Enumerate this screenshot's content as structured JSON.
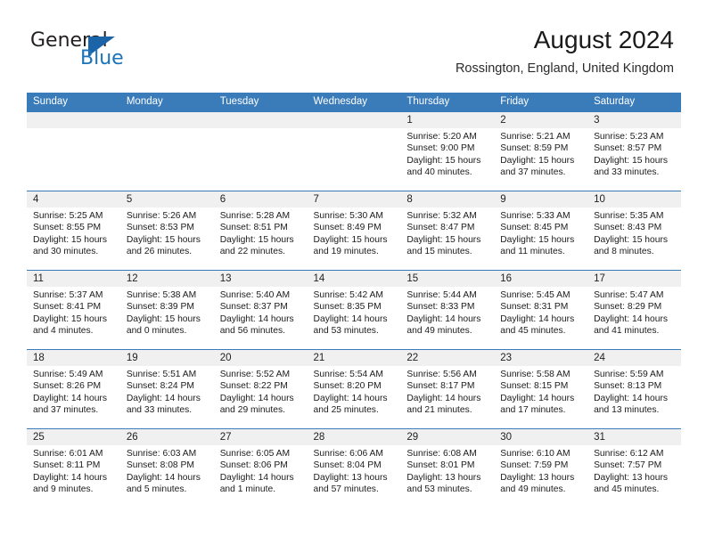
{
  "brand": {
    "name_part1": "General",
    "name_part2": "Blue",
    "triangle_icon": "triangle-logo-icon",
    "accent_color": "#1b74bb"
  },
  "header": {
    "title": "August 2024",
    "subtitle": "Rossington, England, United Kingdom"
  },
  "theme": {
    "header_row_bg": "#3a7cba",
    "daynum_band_bg": "#f0f0f0",
    "row_separator": "#3a7cba",
    "text_color": "#1b1b1b"
  },
  "weekdays": [
    "Sunday",
    "Monday",
    "Tuesday",
    "Wednesday",
    "Thursday",
    "Friday",
    "Saturday"
  ],
  "labels": {
    "sunrise_prefix": "Sunrise:",
    "sunset_prefix": "Sunset:",
    "daylight_prefix": "Daylight:"
  },
  "weeks": [
    [
      {
        "day": "",
        "sunrise": "",
        "sunset": "",
        "daylight_line1": "",
        "daylight_line2": ""
      },
      {
        "day": "",
        "sunrise": "",
        "sunset": "",
        "daylight_line1": "",
        "daylight_line2": ""
      },
      {
        "day": "",
        "sunrise": "",
        "sunset": "",
        "daylight_line1": "",
        "daylight_line2": ""
      },
      {
        "day": "",
        "sunrise": "",
        "sunset": "",
        "daylight_line1": "",
        "daylight_line2": ""
      },
      {
        "day": "1",
        "sunrise": "Sunrise: 5:20 AM",
        "sunset": "Sunset: 9:00 PM",
        "daylight_line1": "Daylight: 15 hours",
        "daylight_line2": "and 40 minutes."
      },
      {
        "day": "2",
        "sunrise": "Sunrise: 5:21 AM",
        "sunset": "Sunset: 8:59 PM",
        "daylight_line1": "Daylight: 15 hours",
        "daylight_line2": "and 37 minutes."
      },
      {
        "day": "3",
        "sunrise": "Sunrise: 5:23 AM",
        "sunset": "Sunset: 8:57 PM",
        "daylight_line1": "Daylight: 15 hours",
        "daylight_line2": "and 33 minutes."
      }
    ],
    [
      {
        "day": "4",
        "sunrise": "Sunrise: 5:25 AM",
        "sunset": "Sunset: 8:55 PM",
        "daylight_line1": "Daylight: 15 hours",
        "daylight_line2": "and 30 minutes."
      },
      {
        "day": "5",
        "sunrise": "Sunrise: 5:26 AM",
        "sunset": "Sunset: 8:53 PM",
        "daylight_line1": "Daylight: 15 hours",
        "daylight_line2": "and 26 minutes."
      },
      {
        "day": "6",
        "sunrise": "Sunrise: 5:28 AM",
        "sunset": "Sunset: 8:51 PM",
        "daylight_line1": "Daylight: 15 hours",
        "daylight_line2": "and 22 minutes."
      },
      {
        "day": "7",
        "sunrise": "Sunrise: 5:30 AM",
        "sunset": "Sunset: 8:49 PM",
        "daylight_line1": "Daylight: 15 hours",
        "daylight_line2": "and 19 minutes."
      },
      {
        "day": "8",
        "sunrise": "Sunrise: 5:32 AM",
        "sunset": "Sunset: 8:47 PM",
        "daylight_line1": "Daylight: 15 hours",
        "daylight_line2": "and 15 minutes."
      },
      {
        "day": "9",
        "sunrise": "Sunrise: 5:33 AM",
        "sunset": "Sunset: 8:45 PM",
        "daylight_line1": "Daylight: 15 hours",
        "daylight_line2": "and 11 minutes."
      },
      {
        "day": "10",
        "sunrise": "Sunrise: 5:35 AM",
        "sunset": "Sunset: 8:43 PM",
        "daylight_line1": "Daylight: 15 hours",
        "daylight_line2": "and 8 minutes."
      }
    ],
    [
      {
        "day": "11",
        "sunrise": "Sunrise: 5:37 AM",
        "sunset": "Sunset: 8:41 PM",
        "daylight_line1": "Daylight: 15 hours",
        "daylight_line2": "and 4 minutes."
      },
      {
        "day": "12",
        "sunrise": "Sunrise: 5:38 AM",
        "sunset": "Sunset: 8:39 PM",
        "daylight_line1": "Daylight: 15 hours",
        "daylight_line2": "and 0 minutes."
      },
      {
        "day": "13",
        "sunrise": "Sunrise: 5:40 AM",
        "sunset": "Sunset: 8:37 PM",
        "daylight_line1": "Daylight: 14 hours",
        "daylight_line2": "and 56 minutes."
      },
      {
        "day": "14",
        "sunrise": "Sunrise: 5:42 AM",
        "sunset": "Sunset: 8:35 PM",
        "daylight_line1": "Daylight: 14 hours",
        "daylight_line2": "and 53 minutes."
      },
      {
        "day": "15",
        "sunrise": "Sunrise: 5:44 AM",
        "sunset": "Sunset: 8:33 PM",
        "daylight_line1": "Daylight: 14 hours",
        "daylight_line2": "and 49 minutes."
      },
      {
        "day": "16",
        "sunrise": "Sunrise: 5:45 AM",
        "sunset": "Sunset: 8:31 PM",
        "daylight_line1": "Daylight: 14 hours",
        "daylight_line2": "and 45 minutes."
      },
      {
        "day": "17",
        "sunrise": "Sunrise: 5:47 AM",
        "sunset": "Sunset: 8:29 PM",
        "daylight_line1": "Daylight: 14 hours",
        "daylight_line2": "and 41 minutes."
      }
    ],
    [
      {
        "day": "18",
        "sunrise": "Sunrise: 5:49 AM",
        "sunset": "Sunset: 8:26 PM",
        "daylight_line1": "Daylight: 14 hours",
        "daylight_line2": "and 37 minutes."
      },
      {
        "day": "19",
        "sunrise": "Sunrise: 5:51 AM",
        "sunset": "Sunset: 8:24 PM",
        "daylight_line1": "Daylight: 14 hours",
        "daylight_line2": "and 33 minutes."
      },
      {
        "day": "20",
        "sunrise": "Sunrise: 5:52 AM",
        "sunset": "Sunset: 8:22 PM",
        "daylight_line1": "Daylight: 14 hours",
        "daylight_line2": "and 29 minutes."
      },
      {
        "day": "21",
        "sunrise": "Sunrise: 5:54 AM",
        "sunset": "Sunset: 8:20 PM",
        "daylight_line1": "Daylight: 14 hours",
        "daylight_line2": "and 25 minutes."
      },
      {
        "day": "22",
        "sunrise": "Sunrise: 5:56 AM",
        "sunset": "Sunset: 8:17 PM",
        "daylight_line1": "Daylight: 14 hours",
        "daylight_line2": "and 21 minutes."
      },
      {
        "day": "23",
        "sunrise": "Sunrise: 5:58 AM",
        "sunset": "Sunset: 8:15 PM",
        "daylight_line1": "Daylight: 14 hours",
        "daylight_line2": "and 17 minutes."
      },
      {
        "day": "24",
        "sunrise": "Sunrise: 5:59 AM",
        "sunset": "Sunset: 8:13 PM",
        "daylight_line1": "Daylight: 14 hours",
        "daylight_line2": "and 13 minutes."
      }
    ],
    [
      {
        "day": "25",
        "sunrise": "Sunrise: 6:01 AM",
        "sunset": "Sunset: 8:11 PM",
        "daylight_line1": "Daylight: 14 hours",
        "daylight_line2": "and 9 minutes."
      },
      {
        "day": "26",
        "sunrise": "Sunrise: 6:03 AM",
        "sunset": "Sunset: 8:08 PM",
        "daylight_line1": "Daylight: 14 hours",
        "daylight_line2": "and 5 minutes."
      },
      {
        "day": "27",
        "sunrise": "Sunrise: 6:05 AM",
        "sunset": "Sunset: 8:06 PM",
        "daylight_line1": "Daylight: 14 hours",
        "daylight_line2": "and 1 minute."
      },
      {
        "day": "28",
        "sunrise": "Sunrise: 6:06 AM",
        "sunset": "Sunset: 8:04 PM",
        "daylight_line1": "Daylight: 13 hours",
        "daylight_line2": "and 57 minutes."
      },
      {
        "day": "29",
        "sunrise": "Sunrise: 6:08 AM",
        "sunset": "Sunset: 8:01 PM",
        "daylight_line1": "Daylight: 13 hours",
        "daylight_line2": "and 53 minutes."
      },
      {
        "day": "30",
        "sunrise": "Sunrise: 6:10 AM",
        "sunset": "Sunset: 7:59 PM",
        "daylight_line1": "Daylight: 13 hours",
        "daylight_line2": "and 49 minutes."
      },
      {
        "day": "31",
        "sunrise": "Sunrise: 6:12 AM",
        "sunset": "Sunset: 7:57 PM",
        "daylight_line1": "Daylight: 13 hours",
        "daylight_line2": "and 45 minutes."
      }
    ]
  ]
}
